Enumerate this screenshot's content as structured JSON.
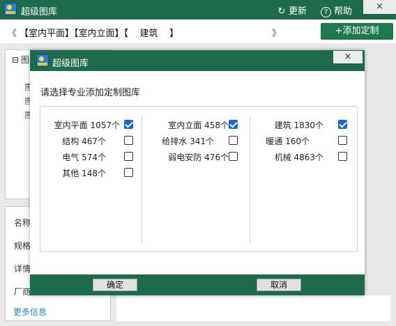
{
  "app": {
    "title": "超级图库"
  },
  "titlebar": {
    "refresh_icon": "↻",
    "refresh_label": "更新",
    "help_icon": "?",
    "help_label": "帮助",
    "close_icon": "×"
  },
  "toolbar": {
    "prev_arrow": "《",
    "next_arrow": "》",
    "breadcrumb": "【室内平面】【室内立面】【    建筑    】",
    "add_custom_label": "+添加定制"
  },
  "tree": {
    "root_toggle": "⊟",
    "root_label": "图",
    "child_toggle": "⊞"
  },
  "info_panel": {
    "rows": [
      "名称",
      "规格",
      "详情",
      "厂商"
    ],
    "more_link": "更多信息"
  },
  "dialog": {
    "title": "超级图库",
    "close_icon": "×",
    "prompt": "请选择专业添加定制图库",
    "columns": [
      {
        "items": [
          {
            "label": "室内平面 1057个",
            "checked": true
          },
          {
            "label": "结构 467个",
            "checked": false
          },
          {
            "label": "电气 574个",
            "checked": false
          },
          {
            "label": "其他 148个",
            "checked": false
          }
        ]
      },
      {
        "items": [
          {
            "label": "室内立面 458个",
            "checked": true
          },
          {
            "label": "给排水 341个",
            "checked": false
          },
          {
            "label": "弱电安防 476个",
            "checked": false
          }
        ]
      },
      {
        "items": [
          {
            "label": "建筑 1830个",
            "checked": true
          },
          {
            "label": "暖通 160个",
            "checked": false
          },
          {
            "label": "机械 4863个",
            "checked": false
          }
        ]
      }
    ],
    "ok_label": "确定",
    "cancel_label": "取消"
  },
  "colors": {
    "brand_green": "#1e6b4c",
    "accent_button": "#1e7a4e",
    "checkbox_blue": "#1967d2",
    "link_blue": "#2d7fd6"
  }
}
